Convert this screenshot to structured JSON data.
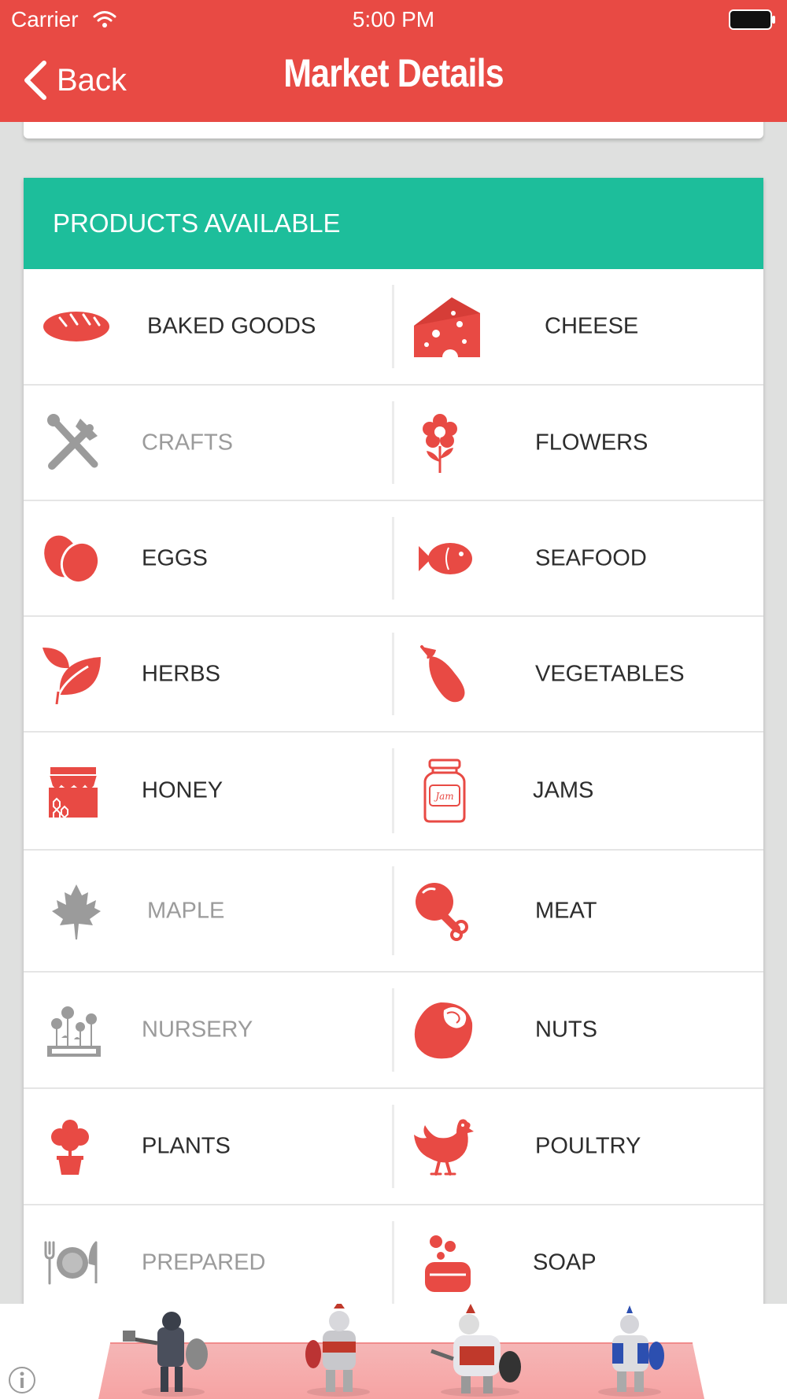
{
  "status_bar": {
    "carrier": "Carrier",
    "time": "5:00 PM"
  },
  "nav": {
    "back_label": "Back",
    "title": "Market Details"
  },
  "products": {
    "header": "PRODUCTS AVAILABLE",
    "accent_color": "#e84a44",
    "muted_color": "#9b9b9b",
    "header_color": "#1dbe9b",
    "rows": [
      {
        "left": {
          "label": "BAKED GOODS",
          "icon": "bread-icon",
          "available": true
        },
        "right": {
          "label": "CHEESE",
          "icon": "cheese-icon",
          "available": true
        }
      },
      {
        "left": {
          "label": "CRAFTS",
          "icon": "crafts-tools-icon",
          "available": false
        },
        "right": {
          "label": "FLOWERS",
          "icon": "flower-icon",
          "available": true
        }
      },
      {
        "left": {
          "label": "EGGS",
          "icon": "eggs-icon",
          "available": true
        },
        "right": {
          "label": "SEAFOOD",
          "icon": "fish-icon",
          "available": true
        }
      },
      {
        "left": {
          "label": "HERBS",
          "icon": "herb-leaves-icon",
          "available": true
        },
        "right": {
          "label": "VEGETABLES",
          "icon": "eggplant-icon",
          "available": true
        }
      },
      {
        "left": {
          "label": "HONEY",
          "icon": "honey-jar-icon",
          "available": true
        },
        "right": {
          "label": "JAMS",
          "icon": "jam-jar-icon",
          "available": true,
          "icon_text": "Jam"
        }
      },
      {
        "left": {
          "label": "MAPLE",
          "icon": "maple-leaf-icon",
          "available": false
        },
        "right": {
          "label": "MEAT",
          "icon": "drumstick-icon",
          "available": true
        }
      },
      {
        "left": {
          "label": "NURSERY",
          "icon": "nursery-planter-icon",
          "available": false
        },
        "right": {
          "label": "NUTS",
          "icon": "nut-icon",
          "available": true
        }
      },
      {
        "left": {
          "label": "PLANTS",
          "icon": "potted-tree-icon",
          "available": true
        },
        "right": {
          "label": "POULTRY",
          "icon": "chicken-icon",
          "available": true
        }
      },
      {
        "left": {
          "label": "PREPARED",
          "icon": "plate-fork-knife-icon",
          "available": false
        },
        "right": {
          "label": "SOAP",
          "icon": "soap-bubbles-icon",
          "available": true
        }
      }
    ]
  },
  "ad": {
    "icon": "info-icon"
  }
}
